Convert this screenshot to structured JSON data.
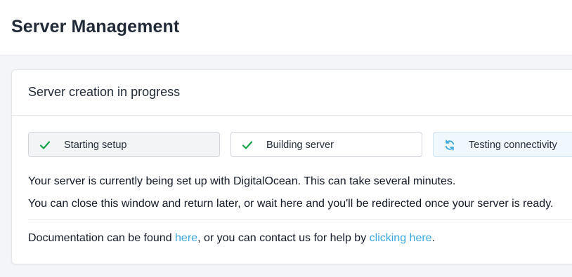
{
  "header": {
    "title": "Server Management"
  },
  "card": {
    "title": "Server creation in progress",
    "steps": [
      {
        "label": "Starting setup",
        "status": "complete",
        "icon": "check-icon"
      },
      {
        "label": "Building server",
        "status": "complete",
        "icon": "check-icon"
      },
      {
        "label": "Testing connectivity",
        "status": "in-progress",
        "icon": "refresh-icon"
      }
    ],
    "message_line1": "Your server is currently being set up with DigitalOcean. This can take several minutes.",
    "message_line2": "You can close this window and return later, or wait here and you'll be redirected once your server is ready.",
    "docs": {
      "prefix": "Documentation can be found ",
      "link1": "here",
      "middle": ", or you can contact us for help by ",
      "link2": "clicking here",
      "suffix": "."
    }
  },
  "colors": {
    "check": "#16a34a",
    "refresh": "#3aa7e0",
    "link": "#3aa7e0",
    "background": "#f3f5f9"
  }
}
